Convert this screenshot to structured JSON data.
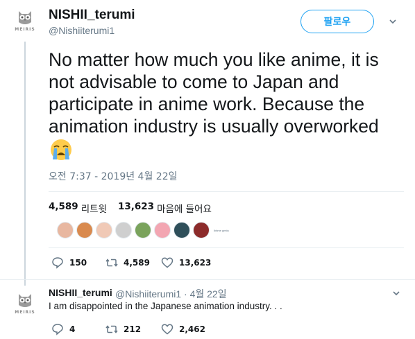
{
  "tweet": {
    "display_name": "NISHII_terumi",
    "handle": "@Nishiiterumi1",
    "follow_label": "팔로우",
    "text": "No matter how much you like anime, it is not advisable to come to Japan and participate in anime work.  Because the animation industry is usually overworked",
    "emoji": "loudly-crying-face",
    "timestamp": "오전 7:37 - 2019년 4월 22일",
    "retweets_count": "4,589",
    "retweets_label": "리트윗",
    "likes_count": "13,623",
    "likes_label": "마음에 들어요",
    "likers": [
      {
        "color": "#e8b7a0"
      },
      {
        "color": "#d98a4e"
      },
      {
        "color": "#f0c9b6"
      },
      {
        "color": "#cfcfcf"
      },
      {
        "color": "#7aa35c"
      },
      {
        "color": "#f3a6b2"
      },
      {
        "color": "#2f4f5a"
      },
      {
        "color": "#8c2b2b"
      }
    ],
    "likers_more": "Ibtime gmtiu",
    "actions": {
      "replies": "150",
      "retweets": "4,589",
      "likes": "13,623"
    }
  },
  "reply": {
    "display_name": "NISHII_terumi",
    "handle_date": "@Nishiiterumi1 · 4월 22일",
    "text": "I am disappointed in the Japanese animation industry. . .",
    "actions": {
      "replies": "4",
      "retweets": "212",
      "likes": "2,462"
    }
  },
  "avatar_logo_text": "MEIRIS",
  "colors": {
    "accent": "#1da1f2",
    "secondary_text": "#657786",
    "primary_text": "#14171a",
    "divider": "#e6ecf0"
  }
}
